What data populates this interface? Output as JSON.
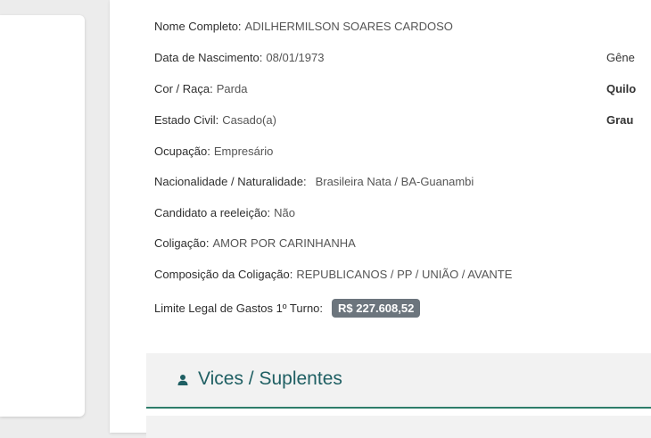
{
  "profile": {
    "nome_label": "Nome Completo:",
    "nome_value": "ADILHERMILSON SOARES CARDOSO",
    "nascimento_label": "Data de Nascimento:",
    "nascimento_value": "08/01/1973",
    "cor_label": "Cor / Raça:",
    "cor_value": "Parda",
    "estado_label": "Estado Civil:",
    "estado_value": "Casado(a)",
    "ocupacao_label": "Ocupação:",
    "ocupacao_value": "Empresário",
    "nacionalidade_label": "Nacionalidade / Naturalidade:",
    "nacionalidade_value": "Brasileira Nata / BA-Guanambi",
    "reeleicao_label": "Candidato a reeleição:",
    "reeleicao_value": "Não",
    "coligacao_label": "Coligação:",
    "coligacao_value": "AMOR POR CARINHANHA",
    "composicao_label": "Composição da Coligação:",
    "composicao_value": "REPUBLICANOS / PP / UNIÃO / AVANTE",
    "limite_label": "Limite Legal de Gastos 1º Turno:",
    "limite_value": "R$ 227.608,52"
  },
  "right_column": {
    "genero_fragment": "Gêne",
    "quilombola_fragment": "Quilo",
    "grau_fragment": "Grau"
  },
  "vices": {
    "title": "Vices / Suplentes"
  },
  "colors": {
    "accent": "#2e7d6a",
    "title": "#1f5f63",
    "badge": "#6c757d"
  }
}
